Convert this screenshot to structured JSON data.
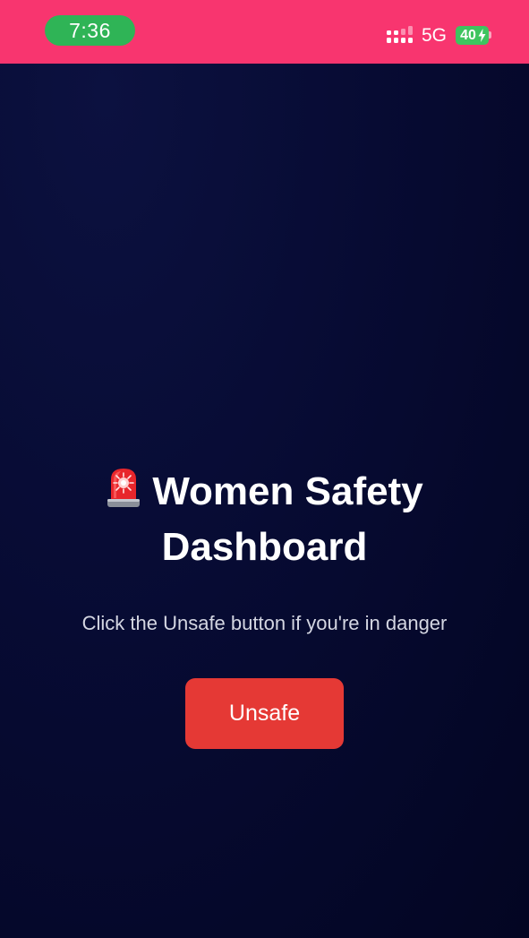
{
  "status_bar": {
    "time": "7:36",
    "network": "5G",
    "battery": "40"
  },
  "main": {
    "title_line1": "Women Safety",
    "title_line2": "Dashboard",
    "subtitle": "Click the Unsafe button if you're in danger",
    "unsafe_label": "Unsafe"
  },
  "icons": {
    "signal": "cellular-signal-icon",
    "bolt": "charging-bolt-icon",
    "siren": "police-siren-icon"
  },
  "colors": {
    "status_bar": "#f8356f",
    "time_pill": "#2fb456",
    "battery": "#3ec45f",
    "background": "#070b33",
    "unsafe_button": "#e53935"
  }
}
